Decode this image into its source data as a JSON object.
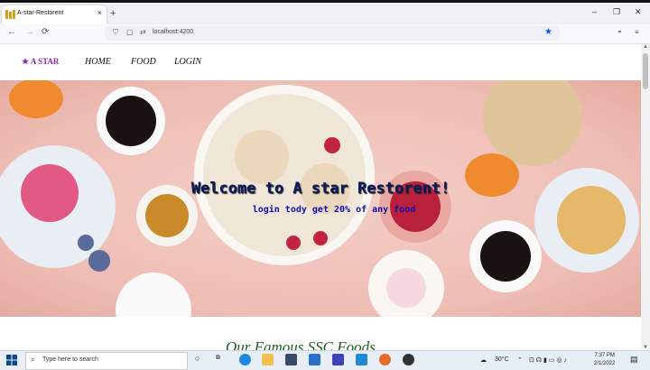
{
  "browser": {
    "tab_title": "A-star-Restorent",
    "tab_close": "×",
    "new_tab": "+",
    "url": "localhost:4200",
    "back": "←",
    "forward": "→",
    "reload": "⟳",
    "win_min": "–",
    "win_restore": "❐",
    "win_close": "✕",
    "bookmark_star": "★",
    "menu": "≡"
  },
  "site": {
    "brand": "A STAR",
    "brand_icon": "star-icon",
    "nav": [
      "HOME",
      "FOOD",
      "LOGIN"
    ],
    "hero_title": "Welcome to A star Restorent!",
    "hero_subtitle": "login tody get 20% of any food",
    "section_title": "Our Famous SSC Foods"
  },
  "taskbar": {
    "search_placeholder": "Type here to search",
    "weather": "30°C",
    "time": "7:37 PM",
    "date": "2/1/2022"
  },
  "colors": {
    "brand": "#8e24aa",
    "hero_title": "#0d1a5a",
    "hero_subtitle": "#1010b0",
    "section_title": "#1b5e20",
    "bookmark": "#0060df"
  }
}
